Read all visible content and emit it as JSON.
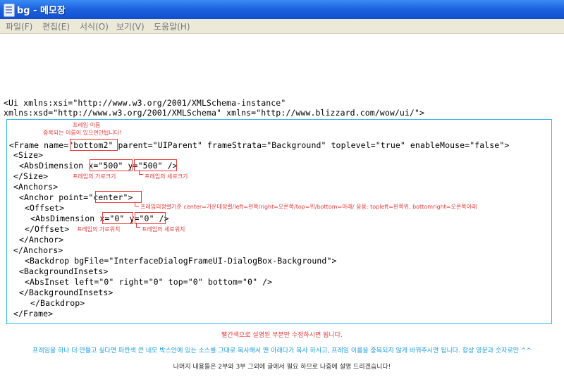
{
  "window": {
    "title": "bg - 메모장",
    "icon": "notepad-icon"
  },
  "menu": [
    {
      "label": "파일(F)"
    },
    {
      "label": "편집(E)"
    },
    {
      "label": "서식(O)"
    },
    {
      "label": "보기(V)"
    },
    {
      "label": "도움말(H)"
    }
  ],
  "code": {
    "l1": "<Ui xmlns:xsi=\"http://www.w3.org/2001/XMLSchema-instance\"",
    "l2": "xmlns:xsd=\"http://www.w3.org/2001/XMLSchema\" xmlns=\"http://www.blizzard.com/wow/ui/\">",
    "l3": "<Frame name=\"bottom2\" parent=\"UIParent\" frameStrata=\"Background\" toplevel=\"true\" enableMouse=\"false\">",
    "l4": "<Size>",
    "l5": "<AbsDimension x=\"500\" y=\"500\" />",
    "l6": "</Size>",
    "l7": "<Anchors>",
    "l8": "<Anchor point=\"center\">",
    "l9": "<Offset>",
    "l10": "<AbsDimension x=\"0\" y=\"0\" />",
    "l11": "</Offset>",
    "l12": "</Anchor>",
    "l13": "</Anchors>",
    "l14": "<Backdrop bgFile=\"InterfaceDialogFrameUI-DialogBox-Background\">",
    "l15": "<BackgroundInsets>",
    "l16": "<AbsInset left=\"0\" right=\"0\" top=\"0\" bottom=\"0\" />",
    "l17": "</BackgroundInsets>",
    "l18": "</Backdrop>",
    "l19": "</Frame>"
  },
  "annotations": {
    "frame_name_1": "프레임 이름",
    "frame_name_2": "중복되는 이름이 있으면안됩니다!",
    "width": "프레임의 가로크기",
    "height": "프레임의 세로크기",
    "anchor": "프레임의정렬기준 center=가운데정렬/left=왼쪽/right=오른쪽/top=위/bottom=아래/ 응용: topleft=왼쪽위, bottomright=오른쪽아래",
    "x_offset": "프레임의 가로위치",
    "y_offset": "프레임의 세로위치"
  },
  "notes": {
    "red": "빨간색으로 설명된 부분만 수정하시면 됩니다.",
    "blue": "프레임을 하나 더 만들고 싶다면 파란색 큰 네모 박스안에 있는 소스를 그대로 복사해서 맨 아래다가 복사 하시고, 프레임 이름을 중복되지 않게 바꿔주시면 됩니다. 항상 영문과 숫자로만 ^^",
    "gray": "나머지 내용들은 2부와 3부 그외에 글에서 필요 하므로 나중에 설명 드리겠습니다!"
  },
  "colors": {
    "annotation": "#e8393a",
    "box": "#33b5ee",
    "titlebar": "#1f63e0",
    "menubar": "#ece9d8"
  }
}
